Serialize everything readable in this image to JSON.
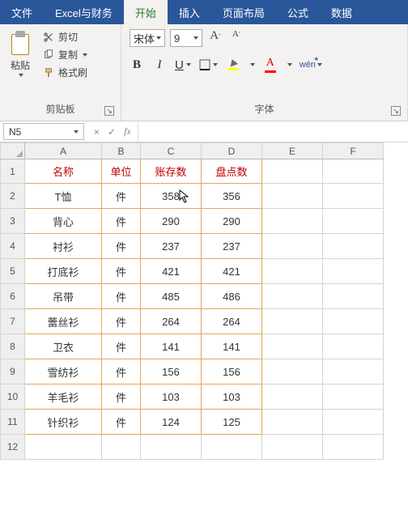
{
  "menu": {
    "file": "文件",
    "addin": "Excel与财务",
    "home": "开始",
    "insert": "插入",
    "layout": "页面布局",
    "formulas": "公式",
    "data": "数据",
    "active": "home"
  },
  "ribbon": {
    "clipboard": {
      "paste": "粘贴",
      "cut": "剪切",
      "copy": "复制",
      "format_painter": "格式刷",
      "group_label": "剪贴板"
    },
    "font": {
      "name": "宋体",
      "size": "9",
      "bold": "B",
      "italic": "I",
      "underline": "U",
      "fill_color": "#ffff00",
      "font_color": "#ff0000",
      "phonetic": "wén",
      "group_label": "字体"
    }
  },
  "namebox": {
    "ref": "N5"
  },
  "formula_bar": {
    "cancel": "×",
    "accept": "✓",
    "fx": "fx",
    "value": ""
  },
  "columns": [
    "A",
    "B",
    "C",
    "D",
    "E",
    "F"
  ],
  "row_numbers": [
    1,
    2,
    3,
    4,
    5,
    6,
    7,
    8,
    9,
    10,
    11,
    12
  ],
  "highlight": {
    "row": 5,
    "col": null
  },
  "table": {
    "headers": [
      "名称",
      "单位",
      "账存数",
      "盘点数"
    ],
    "rows": [
      {
        "name": "T恤",
        "unit": "件",
        "stock": 358,
        "count": 356
      },
      {
        "name": "背心",
        "unit": "件",
        "stock": 290,
        "count": 290
      },
      {
        "name": "衬衫",
        "unit": "件",
        "stock": 237,
        "count": 237
      },
      {
        "name": "打底衫",
        "unit": "件",
        "stock": 421,
        "count": 421
      },
      {
        "name": "吊带",
        "unit": "件",
        "stock": 485,
        "count": 486
      },
      {
        "name": "蕾丝衫",
        "unit": "件",
        "stock": 264,
        "count": 264
      },
      {
        "name": "卫衣",
        "unit": "件",
        "stock": 141,
        "count": 141
      },
      {
        "name": "雪纺衫",
        "unit": "件",
        "stock": 156,
        "count": 156
      },
      {
        "name": "羊毛衫",
        "unit": "件",
        "stock": 103,
        "count": 103
      },
      {
        "name": "针织衫",
        "unit": "件",
        "stock": 124,
        "count": 125
      }
    ]
  },
  "cursor": {
    "over_cell": "C2"
  }
}
